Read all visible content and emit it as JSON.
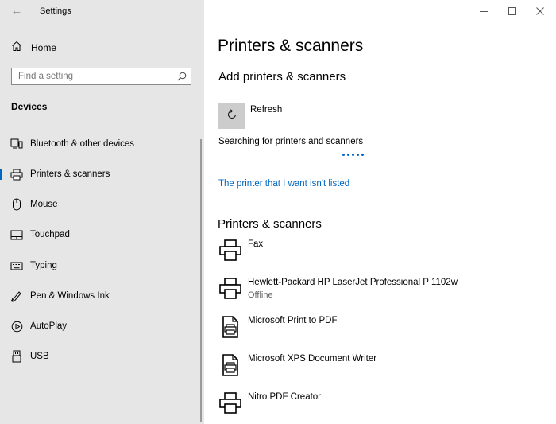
{
  "window": {
    "title": "Settings",
    "back_glyph": "←",
    "controls": {
      "minimize_glyph": "—",
      "maximize_glyph": "☐",
      "close_glyph": "✕"
    }
  },
  "sidebar": {
    "home_label": "Home",
    "search_placeholder": "Find a setting",
    "section_title": "Devices",
    "items": [
      {
        "label": "Bluetooth & other devices",
        "icon": "bluetooth-devices-icon",
        "selected": false
      },
      {
        "label": "Printers & scanners",
        "icon": "printer-icon",
        "selected": true
      },
      {
        "label": "Mouse",
        "icon": "mouse-icon",
        "selected": false
      },
      {
        "label": "Touchpad",
        "icon": "touchpad-icon",
        "selected": false
      },
      {
        "label": "Typing",
        "icon": "keyboard-icon",
        "selected": false
      },
      {
        "label": "Pen & Windows Ink",
        "icon": "pen-icon",
        "selected": false
      },
      {
        "label": "AutoPlay",
        "icon": "autoplay-icon",
        "selected": false
      },
      {
        "label": "USB",
        "icon": "usb-icon",
        "selected": false
      }
    ]
  },
  "main": {
    "page_title": "Printers & scanners",
    "add_section_title": "Add printers & scanners",
    "refresh_label": "Refresh",
    "searching_text": "Searching for printers and scanners",
    "not_listed_link": "The printer that I want isn't listed",
    "list_section_title": "Printers & scanners",
    "printers": [
      {
        "name": "Fax",
        "status": "",
        "icon": "printer-icon"
      },
      {
        "name": "Hewlett-Packard HP LaserJet Professional P 1102w",
        "status": "Offline",
        "icon": "printer-icon"
      },
      {
        "name": "Microsoft Print to PDF",
        "status": "",
        "icon": "document-printer-icon"
      },
      {
        "name": "Microsoft XPS Document Writer",
        "status": "",
        "icon": "document-printer-icon"
      },
      {
        "name": "Nitro PDF Creator",
        "status": "",
        "icon": "printer-icon"
      }
    ]
  },
  "colors": {
    "accent": "#0067c0",
    "sidebar_bg": "#e6e6e6",
    "refresh_tile": "#cccccc"
  }
}
